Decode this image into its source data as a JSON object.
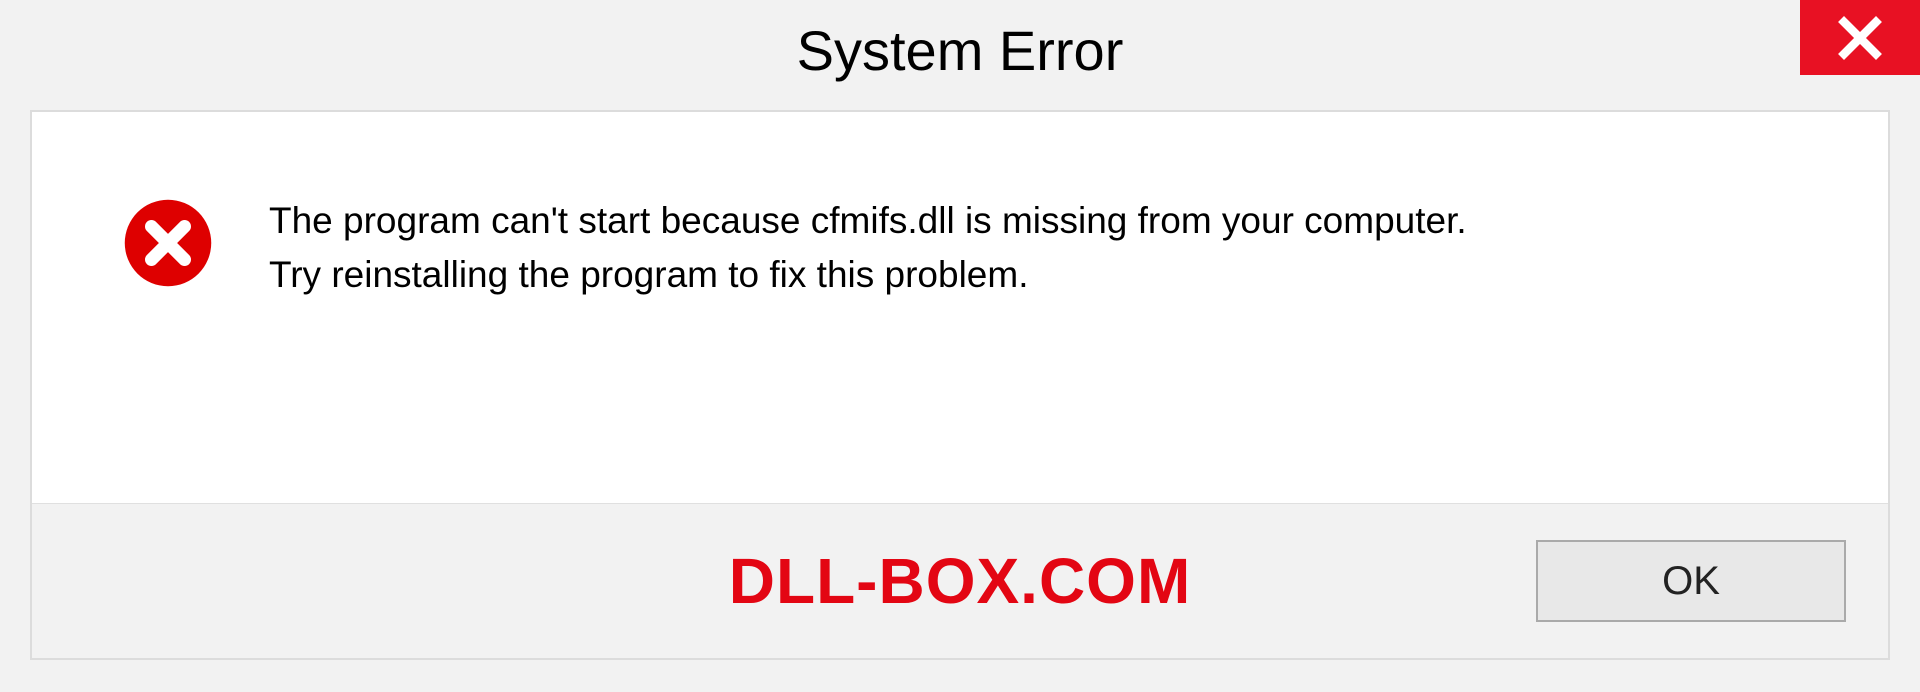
{
  "titlebar": {
    "title": "System Error",
    "close_icon": "close"
  },
  "dialog": {
    "message_line1": "The program can't start because cfmifs.dll is missing from your computer.",
    "message_line2": "Try reinstalling the program to fix this problem.",
    "error_icon": "error-circle-x"
  },
  "footer": {
    "watermark": "DLL-BOX.COM",
    "ok_label": "OK"
  },
  "colors": {
    "close_bg": "#e81123",
    "error_red": "#de0000",
    "watermark_red": "#e30613"
  }
}
